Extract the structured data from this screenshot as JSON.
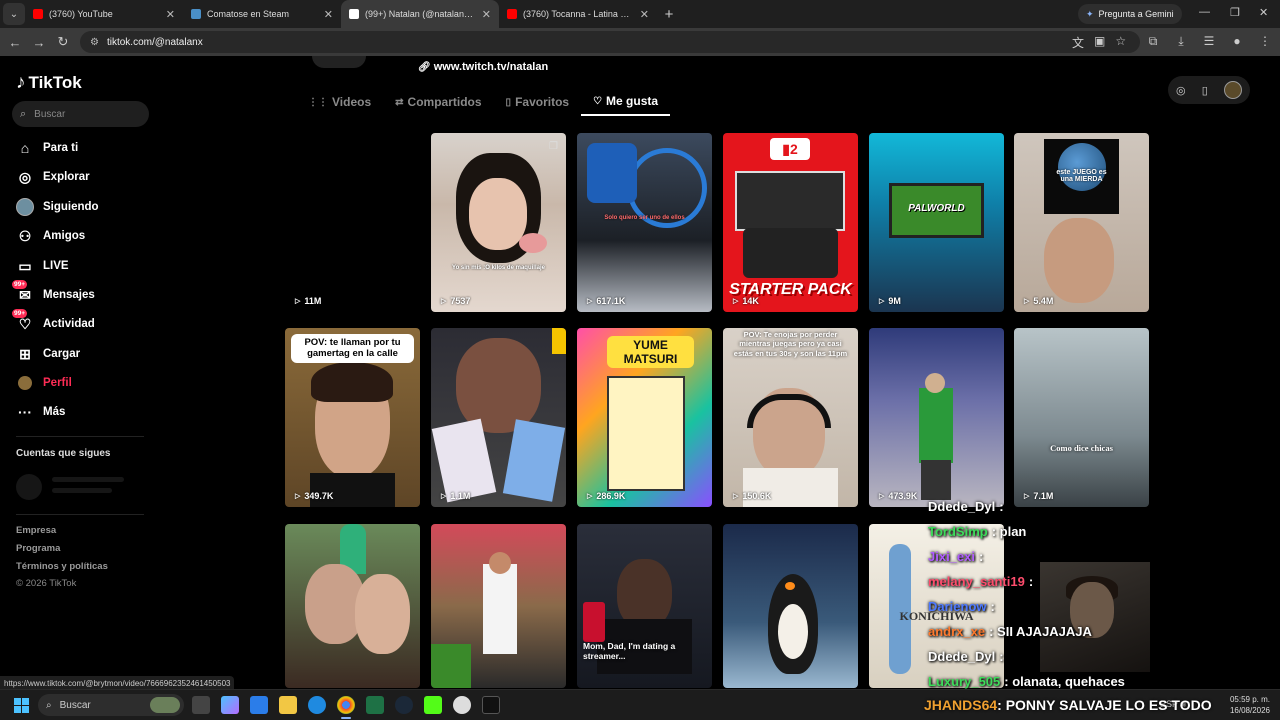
{
  "browser": {
    "tabs": [
      {
        "title": "(3760) YouTube",
        "favicon_color": "#ff0000"
      },
      {
        "title": "Comatose en Steam",
        "favicon_color": "#1b2838"
      },
      {
        "title": "(99+) Natalan (@natalanx) | TikTok",
        "favicon_color": "#000000"
      },
      {
        "title": "(3760) Tocanna - Latina Kawaii",
        "favicon_color": "#ff0000"
      }
    ],
    "active_tab": 2,
    "gemini_label": "Pregunta a Gemini",
    "url": "tiktok.com/@natalanx",
    "status_url": "https://www.tiktok.com/@brytmon/video/7666962352461450503"
  },
  "sidebar": {
    "logo": "TikTok",
    "search_placeholder": "Buscar",
    "items": [
      {
        "label": "Para ti",
        "icon": "home-icon"
      },
      {
        "label": "Explorar",
        "icon": "compass-icon"
      },
      {
        "label": "Siguiendo",
        "icon": "avatar-icon"
      },
      {
        "label": "Amigos",
        "icon": "friends-icon"
      },
      {
        "label": "LIVE",
        "icon": "live-icon"
      },
      {
        "label": "Mensajes",
        "icon": "messages-icon",
        "badge": "99+"
      },
      {
        "label": "Actividad",
        "icon": "activity-icon",
        "badge": "99+"
      },
      {
        "label": "Cargar",
        "icon": "upload-icon"
      },
      {
        "label": "Perfil",
        "icon": "profile-icon"
      },
      {
        "label": "Más",
        "icon": "more-icon"
      }
    ],
    "following_title": "Cuentas que sigues",
    "footer": [
      "Empresa",
      "Programa",
      "Términos y políticas",
      "© 2026 TikTok"
    ]
  },
  "profile": {
    "link": "www.twitch.tv/natalan",
    "tabs": [
      "Videos",
      "Compartidos",
      "Favoritos",
      "Me gusta"
    ],
    "active_tab": 3
  },
  "videos": [
    {
      "views": "11M",
      "caption": ""
    },
    {
      "views": "7537",
      "caption": "Yo sin mis :O kilos de maquillaje"
    },
    {
      "views": "617.1K",
      "caption": "Solo quiero ser uno de ellos"
    },
    {
      "views": "14K",
      "caption": "STARTER PACK"
    },
    {
      "views": "9M",
      "caption": "PALWORLD"
    },
    {
      "views": "5.4M",
      "caption": "este JUEGO es una MIERDA"
    },
    {
      "views": "349.7K",
      "caption": "POV: te llaman por tu gamertag en la calle"
    },
    {
      "views": "1.1M",
      "caption": ""
    },
    {
      "views": "286.9K",
      "caption": "YUME MATSURI"
    },
    {
      "views": "150.6K",
      "caption": "POV: Te enojas por perder mientras juegas pero ya casi estás en tus 30s y son las 11pm"
    },
    {
      "views": "473.9K",
      "caption": ""
    },
    {
      "views": "7.1M",
      "caption": "Como dice chicas"
    },
    {
      "views": "",
      "caption": ""
    },
    {
      "views": "",
      "caption": ""
    },
    {
      "views": "",
      "caption": "Mom, Dad, I'm dating a streamer..."
    },
    {
      "views": "",
      "caption": ""
    },
    {
      "views": "",
      "caption": "KONICHIWA"
    }
  ],
  "chat": [
    {
      "user": "Ddede_Dyl",
      "msg": ":",
      "color": "#ffffff"
    },
    {
      "user": "TordSimp",
      "msg": ": plan",
      "color": "#3ddc5a"
    },
    {
      "user": "Jixi_exi",
      "msg": ":",
      "color": "#b05cff"
    },
    {
      "user": "melany_santi19",
      "msg": ":",
      "color": "#ff4d6d"
    },
    {
      "user": "Darienow",
      "msg": ":",
      "color": "#4d79ff"
    },
    {
      "user": "andrx_xe",
      "msg": ": SII AJAJAJAJA",
      "color": "#ff7a2e"
    },
    {
      "user": "Ddede_Dyl",
      "msg": ":",
      "color": "#ffffff"
    },
    {
      "user": "Luxury_505",
      "msg": ": olanata, quehaces",
      "color": "#3ddc5a"
    }
  ],
  "banner": {
    "user": "JHANDS64",
    "msg": ": PONNY SALVAJE LO ES TODO"
  },
  "taskbar": {
    "search": "Buscar",
    "lang": "ESP",
    "time": "05:59 p. m.",
    "date": "16/08/2026"
  }
}
